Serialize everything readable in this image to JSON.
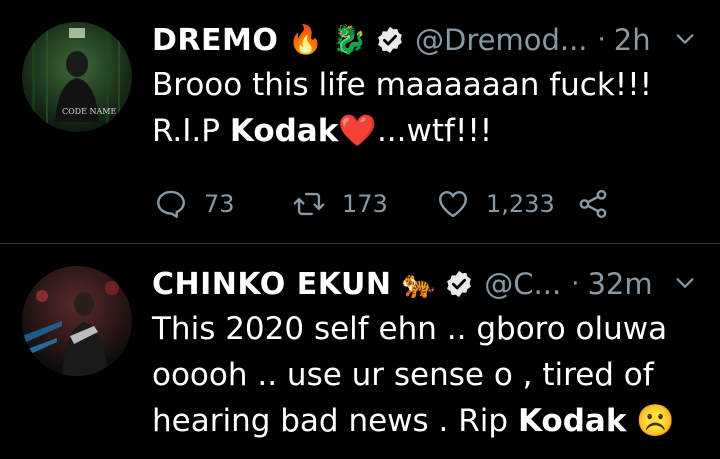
{
  "tweets": [
    {
      "display_name": "DREMO",
      "name_emojis": "🔥 🐉",
      "handle": "@Dremod...",
      "separator": "·",
      "time": "2h",
      "lines": [
        {
          "pre": "Brooo this life maaaaaan fuck!!!",
          "bold": "",
          "post": ""
        },
        {
          "pre": "R.I.P ",
          "bold": "Kodak",
          "post": ""
        }
      ],
      "heart": "❤️",
      "tail": "...wtf!!!",
      "stats": {
        "replies": "73",
        "retweets": "173",
        "likes": "1,233"
      }
    },
    {
      "display_name": "CHINKO EKUN",
      "name_emojis": "🐅",
      "handle": "@C...",
      "separator": "·",
      "time": "32m",
      "lines": [
        {
          "pre": "This 2020 self ehn .. gboro oluwa",
          "bold": "",
          "post": ""
        },
        {
          "pre": "ooooh .. use ur sense o , tired of",
          "bold": "",
          "post": ""
        },
        {
          "pre": "hearing bad news . Rip ",
          "bold": "Kodak",
          "post": " ☹️"
        }
      ]
    }
  ],
  "colors": {
    "background": "#000000",
    "muted": "#8899a6",
    "divider": "#2f3336",
    "heart": "#e0245e"
  },
  "icons": [
    "verified-icon",
    "chevron-down-icon",
    "reply-icon",
    "retweet-icon",
    "like-icon",
    "share-icon"
  ]
}
